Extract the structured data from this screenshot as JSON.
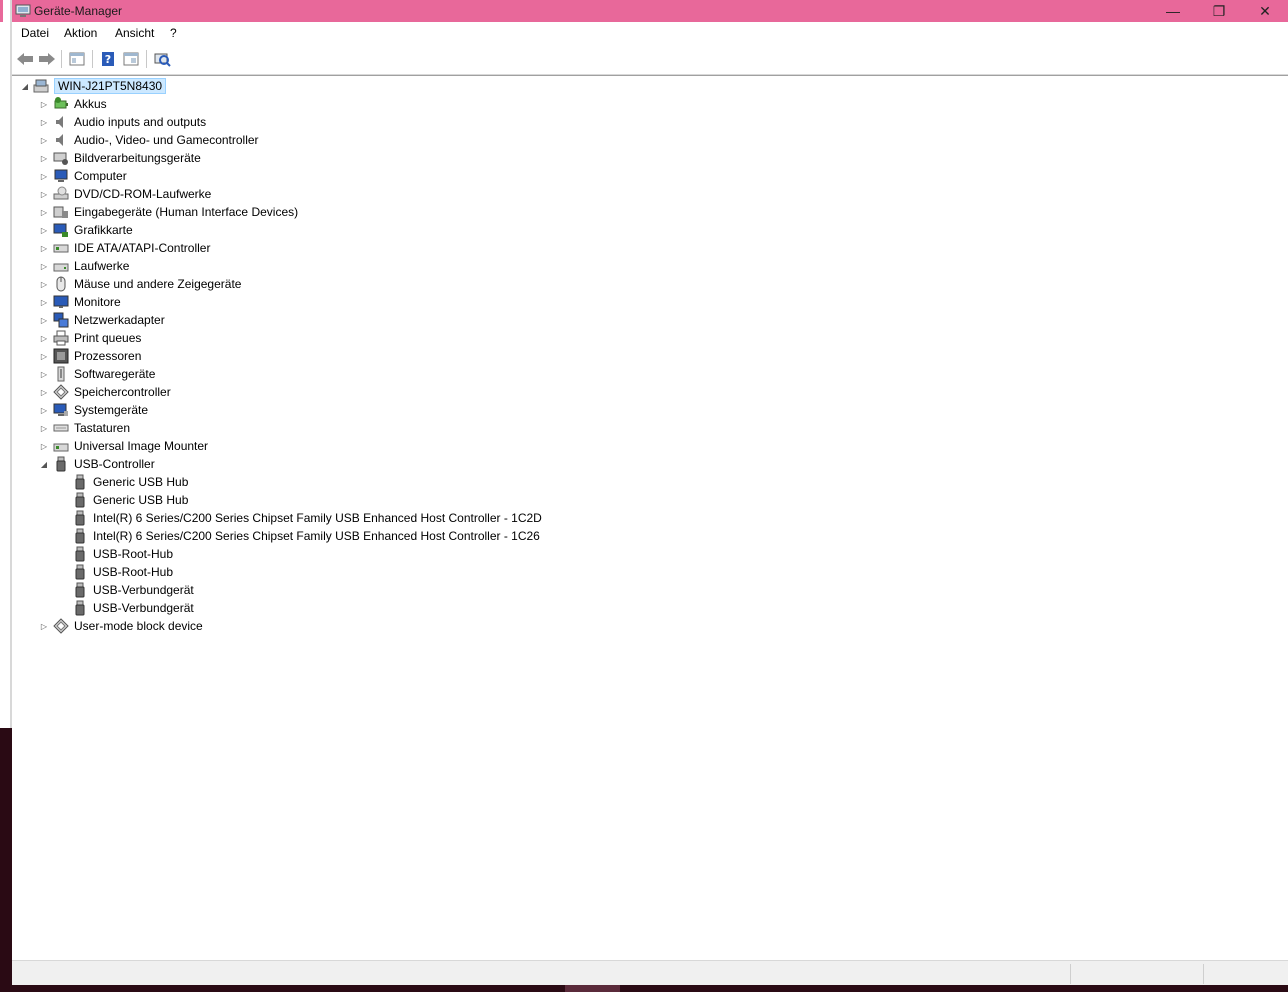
{
  "window": {
    "title": "Geräte-Manager",
    "accent_color": "#e8689a",
    "controls": {
      "minimize": "—",
      "restore": "❐",
      "close": "✕"
    }
  },
  "menu": {
    "items": [
      "Datei",
      "Aktion",
      "Ansicht",
      "?"
    ]
  },
  "toolbar": {
    "buttons": [
      "back-arrow-icon",
      "forward-arrow-icon",
      "properties-icon",
      "help-icon",
      "show-hidden-icon",
      "scan-hardware-icon"
    ]
  },
  "tree": {
    "root": {
      "label": "WIN-J21PT5N8430",
      "expanded": true
    },
    "categories": [
      {
        "label": "Akkus",
        "icon": "battery-icon"
      },
      {
        "label": "Audio inputs and outputs",
        "icon": "speaker-icon"
      },
      {
        "label": "Audio-, Video- und Gamecontroller",
        "icon": "speaker-icon"
      },
      {
        "label": "Bildverarbeitungsgeräte",
        "icon": "camera-icon"
      },
      {
        "label": "Computer",
        "icon": "computer-icon"
      },
      {
        "label": "DVD/CD-ROM-Laufwerke",
        "icon": "dvd-drive-icon"
      },
      {
        "label": "Eingabegeräte (Human Interface Devices)",
        "icon": "hid-icon"
      },
      {
        "label": "Grafikkarte",
        "icon": "display-adapter-icon"
      },
      {
        "label": "IDE ATA/ATAPI-Controller",
        "icon": "ide-controller-icon"
      },
      {
        "label": "Laufwerke",
        "icon": "disk-drive-icon"
      },
      {
        "label": "Mäuse und andere Zeigegeräte",
        "icon": "mouse-icon"
      },
      {
        "label": "Monitore",
        "icon": "monitor-icon"
      },
      {
        "label": "Netzwerkadapter",
        "icon": "network-adapter-icon"
      },
      {
        "label": "Print queues",
        "icon": "printer-icon"
      },
      {
        "label": "Prozessoren",
        "icon": "processor-icon"
      },
      {
        "label": "Softwaregeräte",
        "icon": "software-device-icon"
      },
      {
        "label": "Speichercontroller",
        "icon": "storage-controller-icon"
      },
      {
        "label": "Systemgeräte",
        "icon": "system-device-icon"
      },
      {
        "label": "Tastaturen",
        "icon": "keyboard-icon"
      },
      {
        "label": "Universal Image Mounter",
        "icon": "image-mounter-icon"
      },
      {
        "label": "USB-Controller",
        "icon": "usb-icon",
        "expanded": true,
        "children": [
          "Generic USB Hub",
          "Generic USB Hub",
          "Intel(R) 6 Series/C200 Series Chipset Family USB Enhanced Host Controller - 1C2D",
          "Intel(R) 6 Series/C200 Series Chipset Family USB Enhanced Host Controller - 1C26",
          "USB-Root-Hub",
          "USB-Root-Hub",
          "USB-Verbundgerät",
          "USB-Verbundgerät"
        ]
      },
      {
        "label": "User-mode block device",
        "icon": "storage-controller-icon"
      }
    ]
  }
}
